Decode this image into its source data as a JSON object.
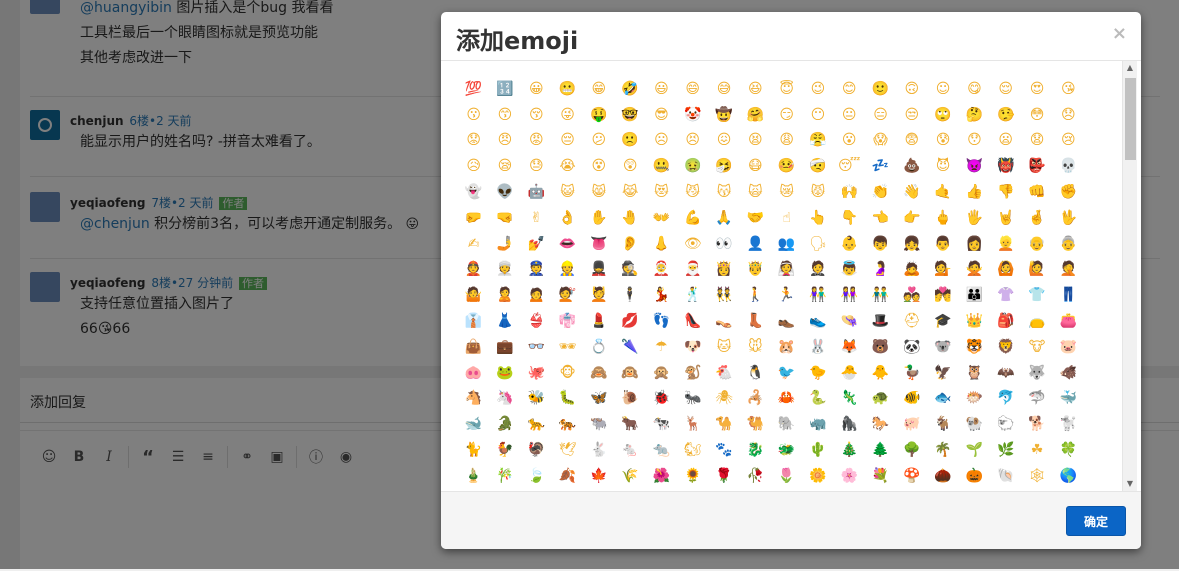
{
  "comments": [
    {
      "user": "",
      "meta": "",
      "badge": "",
      "lines": [
        "@huangyibin 图片插入是个bug 我看看",
        "工具栏最后一个眼睛图标就是预览功能",
        "其他考虑改进一下"
      ]
    },
    {
      "user": "chenjun",
      "meta": "6楼•2 天前",
      "badge": "",
      "lines": [
        "能显示用户的姓名吗? -拼音太难看了。"
      ]
    },
    {
      "user": "yeqiaofeng",
      "meta": "7楼•2 天前",
      "badge": "作者",
      "mention": "@chenjun",
      "lines": [
        "积分榜前3名，可以考虑开通定制服务。"
      ]
    },
    {
      "user": "yeqiaofeng",
      "meta": "8楼•27 分钟前",
      "badge": "作者",
      "lines": [
        "支持任意位置插入图片了",
        "66😘66"
      ]
    }
  ],
  "reply": {
    "title": "添加回复",
    "toolbar_icons": [
      "smile-icon",
      "bold-icon",
      "italic-icon",
      "quote-icon",
      "unordered-list-icon",
      "ordered-list-icon",
      "link-icon",
      "image-icon",
      "info-icon",
      "eye-icon"
    ]
  },
  "modal": {
    "title": "添加emoji",
    "close": "×",
    "confirm": "确定",
    "emojis": [
      "💯",
      "🔢",
      "😀",
      "😬",
      "😁",
      "🤣",
      "😃",
      "😄",
      "😅",
      "😆",
      "😇",
      "😉",
      "😊",
      "🙂",
      "🙃",
      "☺",
      "😋",
      "😌",
      "😍",
      "😘",
      "😗",
      "😙",
      "😚",
      "😜",
      "🤑",
      "🤓",
      "😎",
      "🤡",
      "🤠",
      "🤗",
      "😏",
      "😶",
      "😐",
      "😑",
      "😒",
      "🙄",
      "🤔",
      "🤥",
      "😳",
      "😞",
      "😟",
      "😠",
      "😡",
      "😔",
      "😕",
      "🙁",
      "☹",
      "😣",
      "😖",
      "😫",
      "😩",
      "😤",
      "😮",
      "😱",
      "😨",
      "😰",
      "😯",
      "😦",
      "😧",
      "😢",
      "😥",
      "😪",
      "😓",
      "😭",
      "😵",
      "😲",
      "🤐",
      "🤢",
      "🤧",
      "😷",
      "🤒",
      "🤕",
      "😴",
      "💤",
      "💩",
      "😈",
      "👿",
      "👹",
      "👺",
      "💀",
      "👻",
      "👽",
      "🤖",
      "😺",
      "😸",
      "😹",
      "😻",
      "😼",
      "😽",
      "🙀",
      "😿",
      "😾",
      "🙌",
      "👏",
      "👋",
      "🤙",
      "👍",
      "👎",
      "👊",
      "✊",
      "🤛",
      "🤜",
      "✌",
      "👌",
      "✋",
      "🤚",
      "👐",
      "💪",
      "🙏",
      "🤝",
      "☝",
      "👆",
      "👇",
      "👈",
      "👉",
      "🖕",
      "🖐",
      "🤘",
      "🤞",
      "🖖",
      "✍",
      "🤳",
      "💅",
      "👄",
      "👅",
      "👂",
      "👃",
      "👁",
      "👀",
      "👤",
      "👥",
      "🗣",
      "👶",
      "👦",
      "👧",
      "👨",
      "👩",
      "👱",
      "👴",
      "👵",
      "👲",
      "👳",
      "👮",
      "👷",
      "💂",
      "🕵",
      "🤶",
      "🎅",
      "👸",
      "🤴",
      "👰",
      "🤵",
      "👼",
      "🤰",
      "🙇",
      "💁",
      "🙅",
      "🙆",
      "🙋",
      "🤦",
      "🤷",
      "🙎",
      "🙍",
      "💇",
      "💆",
      "🕴",
      "💃",
      "🕺",
      "👯",
      "🚶",
      "🏃",
      "👫",
      "👭",
      "👬",
      "💑",
      "💏",
      "👪",
      "👚",
      "👕",
      "👖",
      "👔",
      "👗",
      "👙",
      "👘",
      "💄",
      "💋",
      "👣",
      "👠",
      "👡",
      "👢",
      "👞",
      "👟",
      "👒",
      "🎩",
      "⛑",
      "🎓",
      "👑",
      "🎒",
      "👝",
      "👛",
      "👜",
      "💼",
      "👓",
      "🕶",
      "💍",
      "🌂",
      "☂",
      "🐶",
      "🐱",
      "🐭",
      "🐹",
      "🐰",
      "🦊",
      "🐻",
      "🐼",
      "🐨",
      "🐯",
      "🦁",
      "🐮",
      "🐷",
      "🐽",
      "🐸",
      "🐙",
      "🐵",
      "🙈",
      "🙉",
      "🙊",
      "🐒",
      "🐔",
      "🐧",
      "🐦",
      "🐤",
      "🐣",
      "🐥",
      "🦆",
      "🦅",
      "🦉",
      "🦇",
      "🐺",
      "🐗",
      "🐴",
      "🦄",
      "🐝",
      "🐛",
      "🦋",
      "🐌",
      "🐞",
      "🐜",
      "🕷",
      "🦂",
      "🦀",
      "🐍",
      "🦎",
      "🐢",
      "🐠",
      "🐟",
      "🐡",
      "🐬",
      "🦈",
      "🐳",
      "🐋",
      "🐊",
      "🐆",
      "🐅",
      "🐃",
      "🐂",
      "🐄",
      "🦌",
      "🐪",
      "🐫",
      "🐘",
      "🦏",
      "🦍",
      "🐎",
      "🐖",
      "🐐",
      "🐏",
      "🐑",
      "🐕",
      "🐩",
      "🐈",
      "🐓",
      "🦃",
      "🕊",
      "🐇",
      "🐁",
      "🐀",
      "🐿",
      "🐾",
      "🐉",
      "🐲",
      "🌵",
      "🎄",
      "🌲",
      "🌳",
      "🌴",
      "🌱",
      "🌿",
      "☘",
      "🍀",
      "🎍",
      "🎋",
      "🍃",
      "🍂",
      "🍁",
      "🌾",
      "🌺",
      "🌻",
      "🌹",
      "🥀",
      "🌷",
      "🌼",
      "🌸",
      "💐",
      "🍄",
      "🌰",
      "🎃",
      "🐚",
      "🕸",
      "🌎"
    ]
  }
}
